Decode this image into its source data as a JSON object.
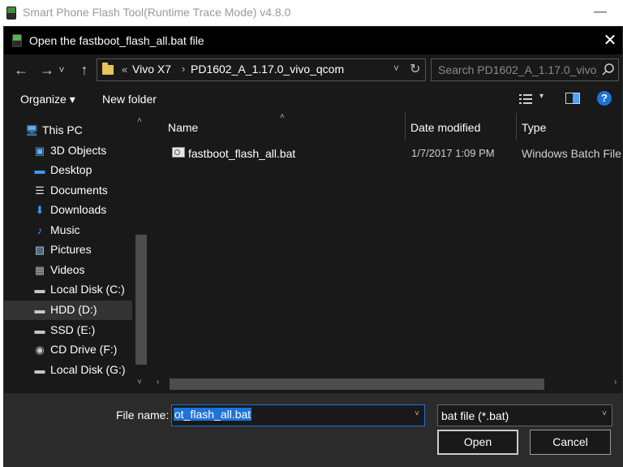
{
  "parent_window": {
    "title": "Smart Phone Flash Tool(Runtime Trace Mode)  v4.8.0",
    "minimize_glyph": "—"
  },
  "dialog": {
    "title": "Open the fastboot_flash_all.bat file",
    "close_glyph": "✕"
  },
  "nav": {
    "back_glyph": "←",
    "forward_glyph": "→",
    "recent_glyph": "˅",
    "up_glyph": "↑",
    "overflow": "«",
    "breadcrumbs": [
      "Vivo X7",
      "PD1602_A_1.17.0_vivo_qcom"
    ],
    "separator": "›",
    "dropdown_glyph": "˅",
    "refresh_glyph": "↻"
  },
  "search": {
    "placeholder": "Search PD1602_A_1.17.0_vivo_..."
  },
  "toolbar": {
    "organize": "Organize ▾",
    "new_folder": "New folder",
    "view_dropdown_glyph": "▾",
    "help": "?"
  },
  "sidebar": {
    "items": [
      {
        "label": "This PC",
        "icon": "computer-icon",
        "glyph": "🖥"
      },
      {
        "label": "3D Objects",
        "icon": "cube-icon",
        "glyph": "▣"
      },
      {
        "label": "Desktop",
        "icon": "desktop-icon",
        "glyph": "▬"
      },
      {
        "label": "Documents",
        "icon": "document-icon",
        "glyph": "☰"
      },
      {
        "label": "Downloads",
        "icon": "download-icon",
        "glyph": "⬇"
      },
      {
        "label": "Music",
        "icon": "music-icon",
        "glyph": "♪"
      },
      {
        "label": "Pictures",
        "icon": "pictures-icon",
        "glyph": "▧"
      },
      {
        "label": "Videos",
        "icon": "video-icon",
        "glyph": "▦"
      },
      {
        "label": "Local Disk (C:)",
        "icon": "drive-icon",
        "glyph": "▬"
      },
      {
        "label": "HDD (D:)",
        "icon": "drive-icon",
        "glyph": "▬"
      },
      {
        "label": "SSD (E:)",
        "icon": "drive-icon",
        "glyph": "▬"
      },
      {
        "label": "CD Drive (F:)",
        "icon": "cd-drive-icon",
        "glyph": "◉"
      },
      {
        "label": "Local Disk (G:)",
        "icon": "drive-icon",
        "glyph": "▬"
      }
    ],
    "selected_index": 9,
    "scroll_up_glyph": "˄",
    "scroll_down_glyph": "˅"
  },
  "file_list": {
    "columns": [
      "Name",
      "Date modified",
      "Type"
    ],
    "sort_glyph": "˄",
    "rows": [
      {
        "name": "fastboot_flash_all.bat",
        "date_modified": "1/7/2017 1:09 PM",
        "type": "Windows Batch File",
        "icon": "batch-file-icon"
      }
    ],
    "scroll_left_glyph": "‹",
    "scroll_right_glyph": "›"
  },
  "bottom": {
    "file_name_label": "File name:",
    "file_name_value": "ot_flash_all.bat",
    "file_name_dropdown_glyph": "˅",
    "filter_value": "bat file (*.bat)",
    "filter_dropdown_glyph": "˅",
    "open_label": "Open",
    "cancel_label": "Cancel"
  },
  "colors": {
    "dialog_bg": "#191919",
    "bottom_bg": "#2b2b2b",
    "accent": "#1e73d6",
    "selected_item_bg": "#333333"
  }
}
